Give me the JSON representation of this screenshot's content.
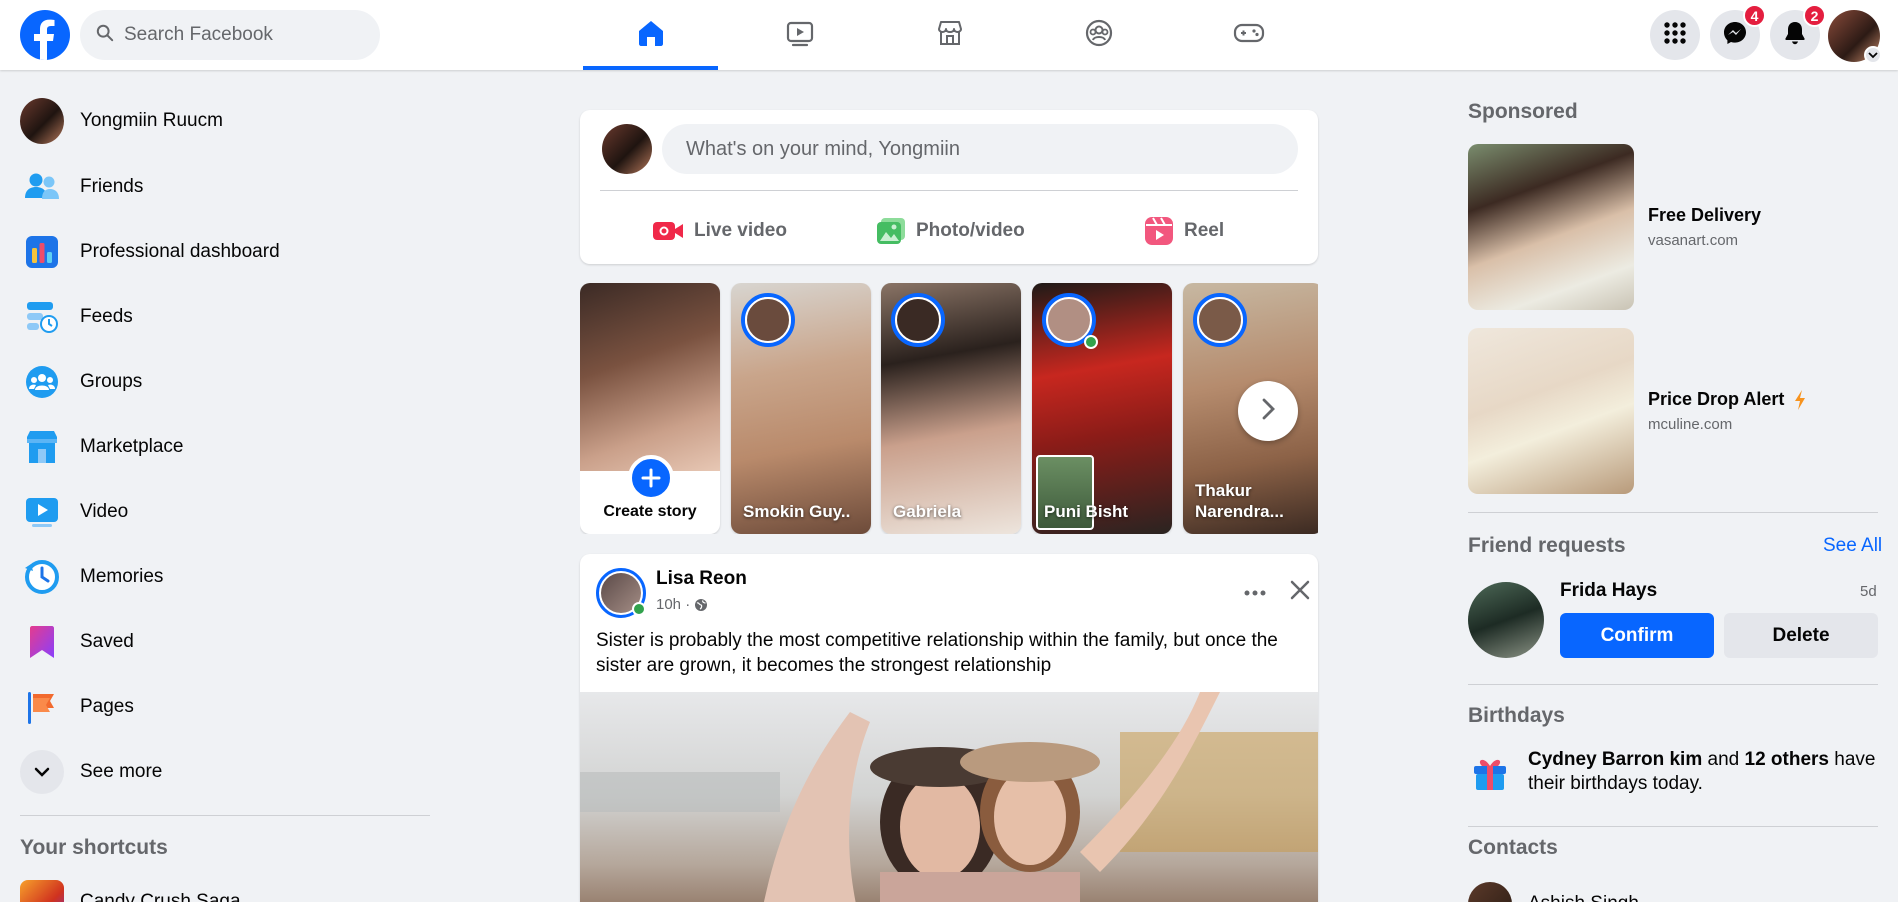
{
  "topbar": {
    "search_placeholder": "Search Facebook",
    "nav_tabs": [
      "home-icon",
      "video-icon",
      "marketplace-icon",
      "groups-icon",
      "gaming-icon"
    ],
    "messenger_badge": "4",
    "notifications_badge": "2",
    "accent": "#0866ff",
    "badge_color": "#e41e3f"
  },
  "sidebar": {
    "profile_name": "Yongmiin Ruucm",
    "items": [
      {
        "label": "Friends",
        "icon": "friends-icon"
      },
      {
        "label": "Professional dashboard",
        "icon": "dashboard-icon"
      },
      {
        "label": "Feeds",
        "icon": "feeds-icon"
      },
      {
        "label": "Groups",
        "icon": "groups-icon"
      },
      {
        "label": "Marketplace",
        "icon": "marketplace-icon"
      },
      {
        "label": "Video",
        "icon": "video-icon"
      },
      {
        "label": "Memories",
        "icon": "memories-icon"
      },
      {
        "label": "Saved",
        "icon": "saved-icon"
      },
      {
        "label": "Pages",
        "icon": "pages-icon"
      }
    ],
    "see_more": "See more",
    "shortcuts_title": "Your shortcuts",
    "shortcut_1": "Candy Crush Saga"
  },
  "composer": {
    "placeholder": "What's on your mind, Yongmiin",
    "actions": [
      "Live video",
      "Photo/video",
      "Reel"
    ]
  },
  "stories": {
    "create_label": "Create story",
    "items": [
      {
        "name": "Smokin Guy.."
      },
      {
        "name": "Gabriela"
      },
      {
        "name": "Puni Bisht"
      },
      {
        "name": "Thakur Narendra..."
      }
    ]
  },
  "post": {
    "author": "Lisa Reon",
    "time": "10h ·",
    "text": "Sister is probably the most competitive relationship within the family, but once the sister  are grown, it becomes the strongest relationship"
  },
  "right": {
    "sponsored_title": "Sponsored",
    "ads": [
      {
        "title": "Free Delivery",
        "url": "vasanart.com"
      },
      {
        "title": "Price Drop Alert",
        "url": "mculine.com"
      }
    ],
    "friend_requests_title": "Friend requests",
    "see_all": "See All",
    "request_name": "Frida Hays",
    "request_time": "5d",
    "confirm": "Confirm",
    "delete": "Delete",
    "birthdays_title": "Birthdays",
    "bday_name": "Cydney Barron kim",
    "bday_and": " and ",
    "bday_others": "12 others",
    "bday_rest": " have their birthdays today.",
    "contacts_title": "Contacts",
    "contact_1": "Ashish Singh"
  }
}
